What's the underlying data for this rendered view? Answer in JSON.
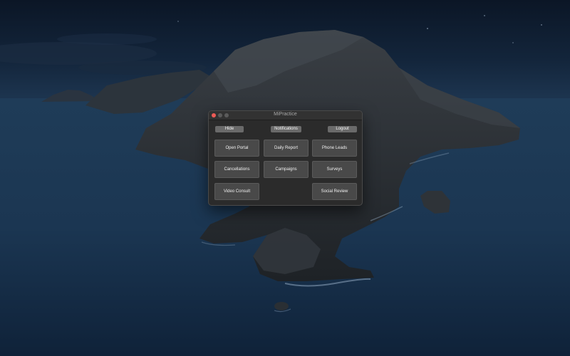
{
  "window": {
    "title": "MiPractice"
  },
  "toolbar": {
    "hide_label": "Hide",
    "notifications_label": "Notifications",
    "logout_label": "Logout"
  },
  "buttons": {
    "open_portal": "Open Portal",
    "daily_report": "Daily Report",
    "phone_leads": "Phone Leads",
    "cancellations": "Cancellations",
    "campaigns": "Campaigns",
    "surveys": "Surveys",
    "video_consult": "Video Consult",
    "social_review": "Social Review"
  },
  "colors": {
    "window_bg": "#2b2b2b",
    "button_bg": "#494949",
    "close_button": "#ee5b56",
    "sea": "#1e3a56",
    "sky": "#0d1a2c"
  }
}
